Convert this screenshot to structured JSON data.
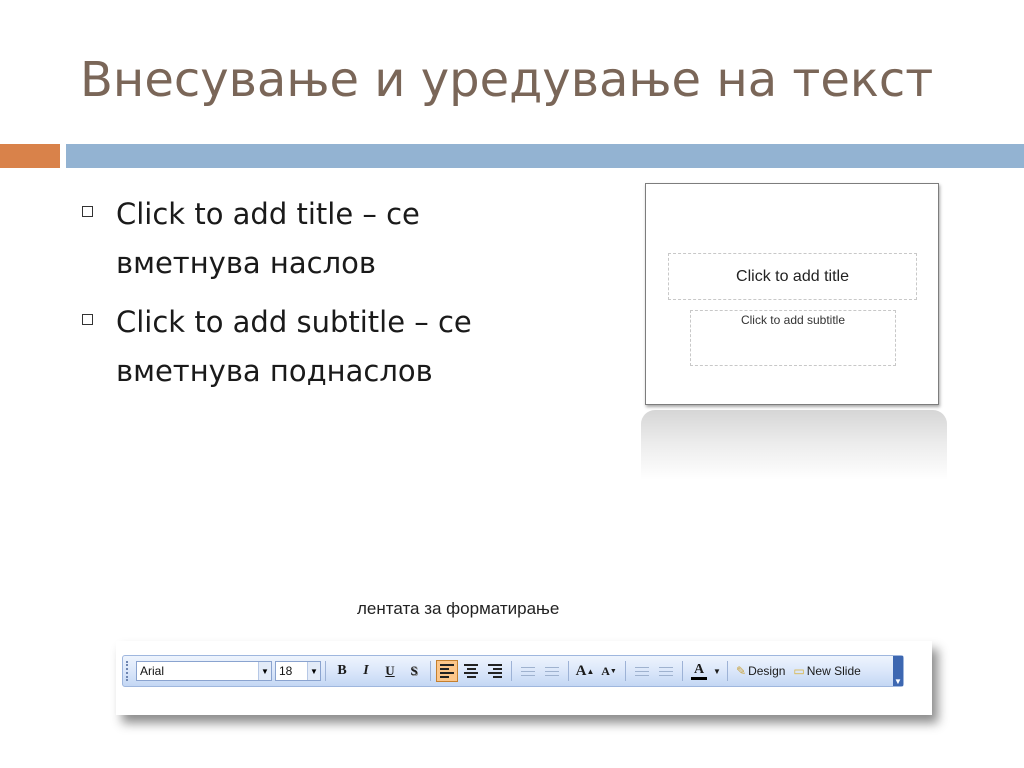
{
  "slide": {
    "title": "Внесување и уредување на текст",
    "bullets": [
      {
        "line1": "Click to add title – се",
        "line2": "вметнува наслов"
      },
      {
        "line1": "Click to add subtitle – се",
        "line2": "вметнува поднаслов"
      }
    ]
  },
  "thumbnail": {
    "title_placeholder": "Click to add title",
    "subtitle_placeholder": "Click to add subtitle"
  },
  "toolbar_caption": "лентата за форматирање",
  "toolbar": {
    "font_name": "Arial",
    "font_size": "18",
    "bold": "B",
    "italic": "I",
    "underline": "U",
    "shadow": "S",
    "increase_font": "A",
    "decrease_font": "A",
    "font_color": "A",
    "design_label": "Design",
    "new_slide_label": "New Slide"
  },
  "colors": {
    "title": "#7a6658",
    "accent_orange": "#d9824a",
    "accent_blue": "#93b3d2"
  }
}
